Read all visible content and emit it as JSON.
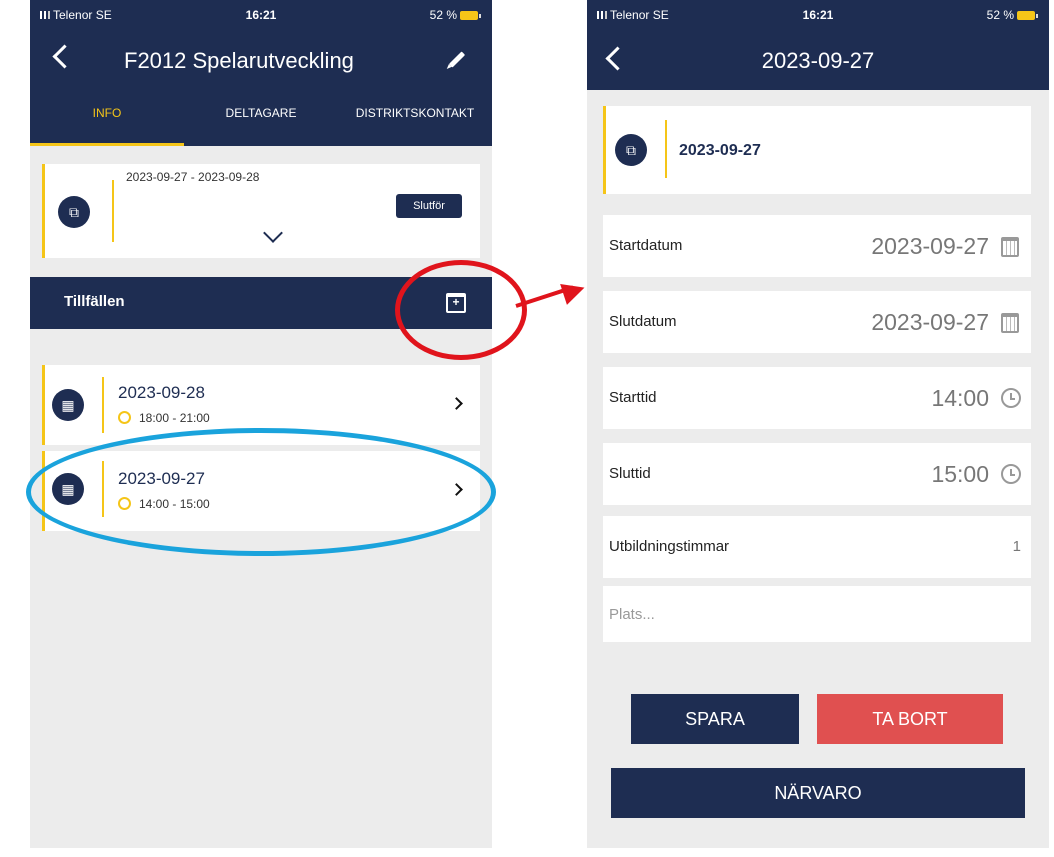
{
  "colors": {
    "navy": "#1e2d52",
    "accent_yellow": "#f5c518",
    "delete_red": "#e05050",
    "annotation_red": "#e0141c",
    "annotation_blue": "#1aa3dc"
  },
  "left": {
    "status": {
      "carrier": "Telenor SE",
      "time": "16:21",
      "battery": "52 %"
    },
    "header": {
      "title": "F2012 Spelarutveckling"
    },
    "tabs": [
      {
        "label": "INFO",
        "active": true
      },
      {
        "label": "DELTAGARE",
        "active": false
      },
      {
        "label": "DISTRIKTSKONTAKT",
        "active": false
      }
    ],
    "course_card": {
      "date_range": "2023-09-27 - 2023-09-28",
      "finish_label": "Slutför"
    },
    "sessions_bar": {
      "label": "Tillfällen"
    },
    "sessions": [
      {
        "date": "2023-09-28",
        "time": "18:00 - 21:00"
      },
      {
        "date": "2023-09-27",
        "time": "14:00 - 15:00"
      }
    ]
  },
  "right": {
    "status": {
      "carrier": "Telenor SE",
      "time": "16:21",
      "battery": "52 %"
    },
    "header": {
      "title": "2023-09-27"
    },
    "summary": {
      "date": "2023-09-27"
    },
    "fields": {
      "start_date": {
        "label": "Startdatum",
        "value": "2023-09-27"
      },
      "end_date": {
        "label": "Slutdatum",
        "value": "2023-09-27"
      },
      "start_time": {
        "label": "Starttid",
        "value": "14:00"
      },
      "end_time": {
        "label": "Sluttid",
        "value": "15:00"
      },
      "hours": {
        "label": "Utbildningstimmar",
        "value": "1"
      },
      "place": {
        "placeholder": "Plats..."
      }
    },
    "buttons": {
      "save": "SPARA",
      "delete": "TA BORT",
      "attendance": "NÄRVARO"
    }
  }
}
